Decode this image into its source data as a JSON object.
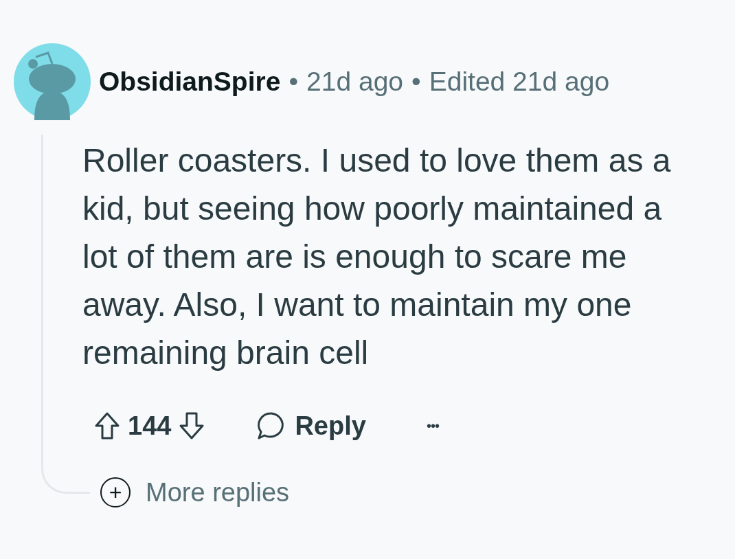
{
  "comment": {
    "author": "ObsidianSpire",
    "separator_1": "•",
    "time": "21d ago",
    "separator_2": "•",
    "edited": "Edited 21d ago",
    "body": "Roller coasters. I used to love them as a kid, but seeing how poorly maintained a lot of them are is enough to scare me away. Also, I want to maintain my one remaining brain cell",
    "score": "144",
    "reply_label": "Reply",
    "more_label": "•••"
  },
  "more_replies": {
    "label": "More replies",
    "icon": "+"
  }
}
